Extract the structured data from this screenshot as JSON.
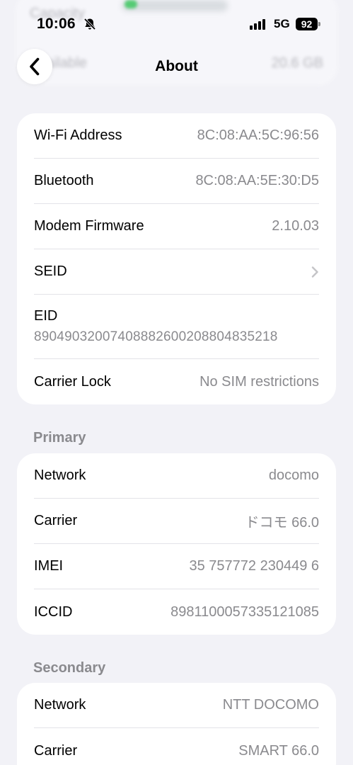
{
  "underlay": {
    "top_label": "Capacity",
    "bottom_label": "Available",
    "bottom_value": "20.6 GB"
  },
  "status_bar": {
    "time": "10:06",
    "network": "5G",
    "battery": "92"
  },
  "nav": {
    "title": "About"
  },
  "device_info": [
    {
      "label": "Wi-Fi Address",
      "value": "8C:08:AA:5C:96:56"
    },
    {
      "label": "Bluetooth",
      "value": "8C:08:AA:5E:30:D5"
    },
    {
      "label": "Modem Firmware",
      "value": "2.10.03"
    },
    {
      "label": "SEID",
      "value": ""
    },
    {
      "label": "EID",
      "value": "89049032007408882600208804835218"
    },
    {
      "label": "Carrier Lock",
      "value": "No SIM restrictions"
    }
  ],
  "primary": {
    "header": "Primary",
    "rows": [
      {
        "label": "Network",
        "value": "docomo"
      },
      {
        "label": "Carrier",
        "value": "ドコモ 66.0"
      },
      {
        "label": "IMEI",
        "value": "35 757772 230449 6"
      },
      {
        "label": "ICCID",
        "value": "8981100057335121085"
      }
    ]
  },
  "secondary": {
    "header": "Secondary",
    "rows": [
      {
        "label": "Network",
        "value": "NTT DOCOMO"
      },
      {
        "label": "Carrier",
        "value": "SMART 66.0"
      }
    ]
  }
}
